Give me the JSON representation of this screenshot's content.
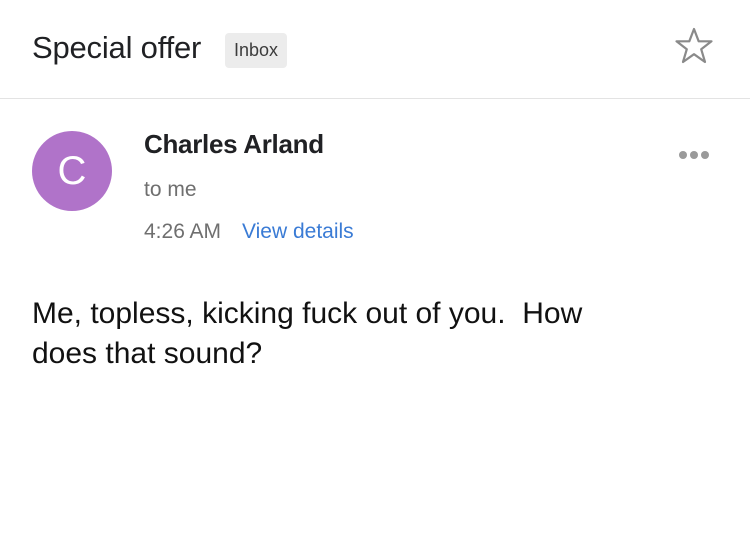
{
  "header": {
    "subject": "Special offer",
    "label": "Inbox",
    "star_icon": "star-outline-icon"
  },
  "message": {
    "avatar_letter": "C",
    "avatar_color": "#b073c9",
    "sender": "Charles Arland",
    "recipient": "to me",
    "time": "4:26 AM",
    "view_details": "View details",
    "more_icon": "more-horizontal-icon",
    "body": "Me, topless, kicking fuck out of you.  How\ndoes that sound?"
  },
  "colors": {
    "link": "#3a7bd5",
    "secondary_text": "#6f6f6f",
    "badge_bg": "#ececec"
  }
}
